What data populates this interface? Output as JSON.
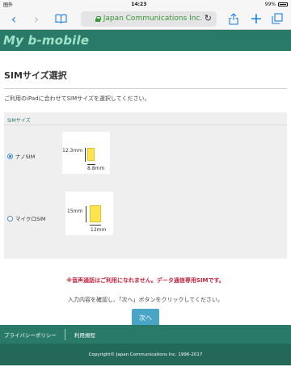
{
  "status_bar": {
    "carrier": "圏外",
    "time": "14:23",
    "battery": "99%"
  },
  "browser": {
    "url": "Japan Communications Inc."
  },
  "brand": {
    "title": "My b-mobile"
  },
  "page": {
    "title": "SIMサイズ選択",
    "lead": "ご利用のiPadに合わせてSIMサイズを選択してください。"
  },
  "sim_panel": {
    "header": "SIMサイズ",
    "options": [
      {
        "label": "ナノSIM",
        "selected": true,
        "height_label": "12.3mm",
        "width_label": "8.8mm"
      },
      {
        "label": "マイクロSIM",
        "selected": false,
        "height_label": "15mm",
        "width_label": "12mm"
      }
    ]
  },
  "notice": {
    "warning": "※音声通話はご利用になれません。データ通信専用SIMです。",
    "instruction": "入力内容を確認し、「次へ」ボタンをクリックしてください。"
  },
  "next_label": "次へ",
  "footer": {
    "links": [
      "プライバシーポリシー",
      "利用規程"
    ],
    "copyright": "Copyright© Japan Communications Inc. 1996-2017"
  },
  "colors": {
    "brand_green": "#2a7a6a",
    "brand_text": "#9fe3c7",
    "warning_red": "#c0233f",
    "button_blue": "#4aa4c8",
    "chip_yellow": "#ffe34f"
  }
}
